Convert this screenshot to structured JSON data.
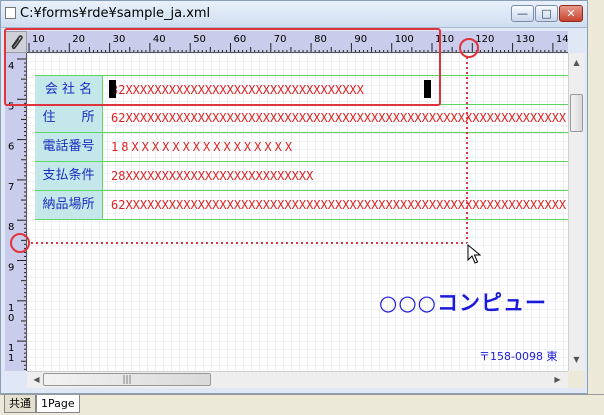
{
  "window": {
    "title": "C:¥forms¥rde¥sample_ja.xml",
    "minimize_label": "—",
    "maximize_label": "□",
    "close_label": "✕"
  },
  "ruler": {
    "horizontal_labels": [
      "10",
      "20",
      "30",
      "40",
      "50",
      "60",
      "70",
      "80",
      "90",
      "100",
      "110",
      "120",
      "130",
      "140"
    ],
    "vertical_labels": [
      "4",
      "5",
      "6",
      "7",
      "8",
      "9",
      "10",
      "11",
      "12"
    ]
  },
  "fields": [
    {
      "label": "会 社 名",
      "value": "32XXXXXXXXXXXXXXXXXXXXXXXXXXXXXXXXX"
    },
    {
      "label": "住　　所",
      "value": "62XXXXXXXXXXXXXXXXXXXXXXXXXXXXXXXXXXXXXXXXXXXXXXXXXXXXXXXXXXXXX"
    },
    {
      "label": "電話番号",
      "value": "18XXXXXXXXXXXXXXXX"
    },
    {
      "label": "支払条件",
      "value": "28XXXXXXXXXXXXXXXXXXXXXXXXXX"
    },
    {
      "label": "納品場所",
      "value": "62XXXXXXXXXXXXXXXXXXXXXXXXXXXXXXXXXXXXXXXXXXXXXXXXXXXXXXXXXXXXX"
    }
  ],
  "canvas": {
    "company_name": "○○○コンピュー",
    "address": "〒158-0098 東"
  },
  "tabs": [
    {
      "label": "共通",
      "active": false
    },
    {
      "label": "1Page",
      "active": true
    }
  ],
  "colors": {
    "highlight": "#e0343c",
    "field_label_bg": "#c4e8ea",
    "field_text": "#1a2cc0",
    "value_text": "#dd2222",
    "grid_line": "#5fd45f"
  },
  "icons": {
    "ruler_corner": "paperclip-icon",
    "cursor": "mouse-pointer-icon"
  }
}
